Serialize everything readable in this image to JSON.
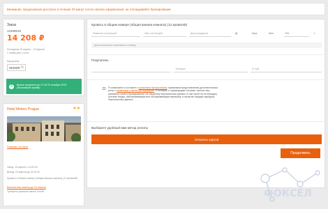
{
  "banner": {
    "text": "Внимание, предложение доступно в течение 20 минут после начала оформления, не откладывайте бронирование"
  },
  "order": {
    "title": "Заказ",
    "id": "11998529",
    "price": "14 208 ₽",
    "nights": "На неделю 15 апреля – 23 апреля",
    "room_count": "1 номер для 1 гостя",
    "comm_label": "Код купона",
    "comm_code": "SKMSR",
    "notice": "Время продлено до 17:18 20 октября 2019 (Московское время)"
  },
  "hotel": {
    "name": "Hotel Meteor Prague",
    "stars": "★★",
    "map_link": "Показать на карте",
    "checkin": "Заезд: 15 апреля с 14:00:00",
    "checkout": "Выезд: 23 апреля до 12:00:00",
    "room_desc": "Кровать в общем номере (общая ванная комната) (12 кроватей)",
    "cancel_link": "Бесплатная отмена до 15 апреля",
    "requirement": "Требуется указание имени гостей"
  },
  "booking": {
    "section1_title": "Кровать в общем номере (общая ванная комната) (12 кроватей)",
    "first_name_ph": "Фамилия латиницей",
    "last_name_ph": "Имя латиницей",
    "birth_ph": "Дата рождения",
    "gender_m": "Муж",
    "gender_f": "Жен",
    "citizenship": "RU",
    "wishes": "Дополнительные пожелания к номеру",
    "section2_title": "Покупатель",
    "buyer_phone_ph": "Телефон",
    "buyer_email_ph": "E-mail",
    "agree_1": "Я ознакомлен и согласен с ",
    "agree_link1": "правилами бронирования",
    "agree_2": ", правилами предоставления дополнительных услуг и ",
    "agree_link2": "правилами отмены бронирования",
    "agree_3": ". Я согласен и подтверждаю согласие третьих лиц, указанных мной в бронировании, на обработку персональных данных, в том числе на их передачу третьим лицам, обеспечивающим или обслуживающим перевозку, в таком же порядке передачу персональных данных.",
    "pay_title": "Выберите удобный вам метод оплаты",
    "pay_button": "Оплатить картой",
    "continue_button": "Продолжить"
  },
  "watermark": {
    "text": "ФОКСЕЛ"
  }
}
